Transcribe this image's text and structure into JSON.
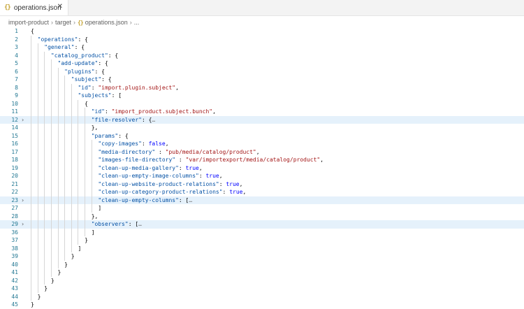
{
  "tab": {
    "icon": "{}",
    "label": "operations.json",
    "close": "✕"
  },
  "breadcrumb": [
    "import-product",
    "target",
    "operations.json",
    "..."
  ],
  "lines": [
    {
      "n": "1",
      "t": [
        [
          "{",
          "p"
        ]
      ],
      "fold": "",
      "hl": false
    },
    {
      "n": "2",
      "t": [
        [
          "  ",
          "p"
        ],
        [
          "\"operations\"",
          "k"
        ],
        [
          ": {",
          "p"
        ]
      ],
      "fold": "",
      "hl": false
    },
    {
      "n": "3",
      "t": [
        [
          "    ",
          "p"
        ],
        [
          "\"general\"",
          "k"
        ],
        [
          ": {",
          "p"
        ]
      ],
      "fold": "",
      "hl": false
    },
    {
      "n": "4",
      "t": [
        [
          "      ",
          "p"
        ],
        [
          "\"catalog_product\"",
          "k"
        ],
        [
          ": {",
          "p"
        ]
      ],
      "fold": "",
      "hl": false
    },
    {
      "n": "5",
      "t": [
        [
          "        ",
          "p"
        ],
        [
          "\"add-update\"",
          "k"
        ],
        [
          ": {",
          "p"
        ]
      ],
      "fold": "",
      "hl": false
    },
    {
      "n": "6",
      "t": [
        [
          "          ",
          "p"
        ],
        [
          "\"plugins\"",
          "k"
        ],
        [
          ": {",
          "p"
        ]
      ],
      "fold": "",
      "hl": false
    },
    {
      "n": "7",
      "t": [
        [
          "            ",
          "p"
        ],
        [
          "\"subject\"",
          "k"
        ],
        [
          ": {",
          "p"
        ]
      ],
      "fold": "",
      "hl": false
    },
    {
      "n": "8",
      "t": [
        [
          "              ",
          "p"
        ],
        [
          "\"id\"",
          "k"
        ],
        [
          ": ",
          "p"
        ],
        [
          "\"import.plugin.subject\"",
          "s"
        ],
        [
          ",",
          "p"
        ]
      ],
      "fold": "",
      "hl": false
    },
    {
      "n": "9",
      "t": [
        [
          "              ",
          "p"
        ],
        [
          "\"subjects\"",
          "k"
        ],
        [
          ": [",
          "p"
        ]
      ],
      "fold": "",
      "hl": false
    },
    {
      "n": "10",
      "t": [
        [
          "                ",
          "p"
        ],
        [
          "{",
          "p"
        ]
      ],
      "fold": "",
      "hl": false
    },
    {
      "n": "11",
      "t": [
        [
          "                  ",
          "p"
        ],
        [
          "\"id\"",
          "k"
        ],
        [
          ": ",
          "p"
        ],
        [
          "\"import_product.subject.bunch\"",
          "s"
        ],
        [
          ",",
          "p"
        ]
      ],
      "fold": "",
      "hl": false
    },
    {
      "n": "12",
      "t": [
        [
          "                  ",
          "p"
        ],
        [
          "\"file-resolver\"",
          "k"
        ],
        [
          ": {",
          "p"
        ],
        [
          "…",
          "e"
        ]
      ],
      "fold": ">",
      "hl": true
    },
    {
      "n": "14",
      "t": [
        [
          "                  ",
          "p"
        ],
        [
          "},",
          "p"
        ]
      ],
      "fold": "",
      "hl": false
    },
    {
      "n": "15",
      "t": [
        [
          "                  ",
          "p"
        ],
        [
          "\"params\"",
          "k"
        ],
        [
          ": {",
          "p"
        ]
      ],
      "fold": "",
      "hl": false
    },
    {
      "n": "16",
      "t": [
        [
          "                    ",
          "p"
        ],
        [
          "\"copy-images\"",
          "k"
        ],
        [
          ": ",
          "p"
        ],
        [
          "false",
          "b"
        ],
        [
          ",",
          "p"
        ]
      ],
      "fold": "",
      "hl": false
    },
    {
      "n": "17",
      "t": [
        [
          "                    ",
          "p"
        ],
        [
          "\"media-directory\"",
          "k"
        ],
        [
          " : ",
          "p"
        ],
        [
          "\"pub/media/catalog/product\"",
          "s"
        ],
        [
          ",",
          "p"
        ]
      ],
      "fold": "",
      "hl": false
    },
    {
      "n": "18",
      "t": [
        [
          "                    ",
          "p"
        ],
        [
          "\"images-file-directory\"",
          "k"
        ],
        [
          " : ",
          "p"
        ],
        [
          "\"var/importexport/media/catalog/product\"",
          "s"
        ],
        [
          ",",
          "p"
        ]
      ],
      "fold": "",
      "hl": false
    },
    {
      "n": "19",
      "t": [
        [
          "                    ",
          "p"
        ],
        [
          "\"clean-up-media-gallery\"",
          "k"
        ],
        [
          ": ",
          "p"
        ],
        [
          "true",
          "b"
        ],
        [
          ",",
          "p"
        ]
      ],
      "fold": "",
      "hl": false
    },
    {
      "n": "20",
      "t": [
        [
          "                    ",
          "p"
        ],
        [
          "\"clean-up-empty-image-columns\"",
          "k"
        ],
        [
          ": ",
          "p"
        ],
        [
          "true",
          "b"
        ],
        [
          ",",
          "p"
        ]
      ],
      "fold": "",
      "hl": false
    },
    {
      "n": "21",
      "t": [
        [
          "                    ",
          "p"
        ],
        [
          "\"clean-up-website-product-relations\"",
          "k"
        ],
        [
          ": ",
          "p"
        ],
        [
          "true",
          "b"
        ],
        [
          ",",
          "p"
        ]
      ],
      "fold": "",
      "hl": false
    },
    {
      "n": "22",
      "t": [
        [
          "                    ",
          "p"
        ],
        [
          "\"clean-up-category-product-relations\"",
          "k"
        ],
        [
          ": ",
          "p"
        ],
        [
          "true",
          "b"
        ],
        [
          ",",
          "p"
        ]
      ],
      "fold": "",
      "hl": false
    },
    {
      "n": "23",
      "t": [
        [
          "                    ",
          "p"
        ],
        [
          "\"clean-up-empty-columns\"",
          "k"
        ],
        [
          ": [",
          "p"
        ],
        [
          "…",
          "e"
        ]
      ],
      "fold": ">",
      "hl": true
    },
    {
      "n": "27",
      "t": [
        [
          "                    ",
          "p"
        ],
        [
          "]",
          "p"
        ]
      ],
      "fold": "",
      "hl": false
    },
    {
      "n": "28",
      "t": [
        [
          "                  ",
          "p"
        ],
        [
          "},",
          "p"
        ]
      ],
      "fold": "",
      "hl": false
    },
    {
      "n": "29",
      "t": [
        [
          "                  ",
          "p"
        ],
        [
          "\"observers\"",
          "k"
        ],
        [
          ": [",
          "p"
        ],
        [
          "…",
          "e"
        ]
      ],
      "fold": ">",
      "hl": true
    },
    {
      "n": "36",
      "t": [
        [
          "                  ",
          "p"
        ],
        [
          "]",
          "p"
        ]
      ],
      "fold": "",
      "hl": false
    },
    {
      "n": "37",
      "t": [
        [
          "                ",
          "p"
        ],
        [
          "}",
          "p"
        ]
      ],
      "fold": "",
      "hl": false
    },
    {
      "n": "38",
      "t": [
        [
          "              ",
          "p"
        ],
        [
          "]",
          "p"
        ]
      ],
      "fold": "",
      "hl": false
    },
    {
      "n": "39",
      "t": [
        [
          "            ",
          "p"
        ],
        [
          "}",
          "p"
        ]
      ],
      "fold": "",
      "hl": false
    },
    {
      "n": "40",
      "t": [
        [
          "          ",
          "p"
        ],
        [
          "}",
          "p"
        ]
      ],
      "fold": "",
      "hl": false
    },
    {
      "n": "41",
      "t": [
        [
          "        ",
          "p"
        ],
        [
          "}",
          "p"
        ]
      ],
      "fold": "",
      "hl": false
    },
    {
      "n": "42",
      "t": [
        [
          "      ",
          "p"
        ],
        [
          "}",
          "p"
        ]
      ],
      "fold": "",
      "hl": false
    },
    {
      "n": "43",
      "t": [
        [
          "    ",
          "p"
        ],
        [
          "}",
          "p"
        ]
      ],
      "fold": "",
      "hl": false
    },
    {
      "n": "44",
      "t": [
        [
          "  ",
          "p"
        ],
        [
          "}",
          "p"
        ]
      ],
      "fold": "",
      "hl": false
    },
    {
      "n": "45",
      "t": [
        [
          "}",
          "p"
        ]
      ],
      "fold": "",
      "hl": false
    }
  ],
  "colors": {
    "key": "#0451a5",
    "string": "#a31515",
    "boolean": "#0000ff",
    "line_number": "#237893",
    "highlight": "#e5f1fb"
  }
}
